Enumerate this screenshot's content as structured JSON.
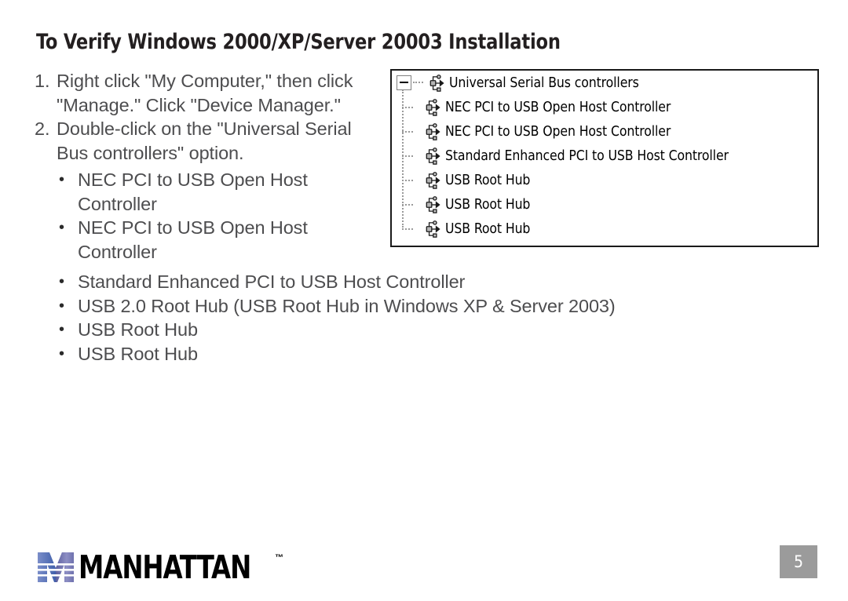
{
  "page": {
    "title": "To Verify Windows 2000/XP/Server 20003 Installation",
    "number": "5"
  },
  "instructions": {
    "steps": [
      {
        "marker": "1.",
        "line1": "Right click \"My Computer,\" then click",
        "line2": "\"Manage.\" Click \"Device Manager.\""
      },
      {
        "marker": "2.",
        "line1": "Double-click on the \"Universal Serial",
        "line2": "Bus controllers\" option."
      }
    ],
    "indented_bullets": [
      "NEC PCI to USB Open Host",
      "Controller",
      "NEC PCI to USB Open Host",
      "Controller"
    ],
    "bullets": [
      "Standard Enhanced PCI to USB Host Controller",
      "USB 2.0 Root Hub (USB Root Hub in Windows XP & Server 2003)",
      "USB Root Hub",
      "USB Root Hub"
    ]
  },
  "device_tree": {
    "root": {
      "label": "Universal Serial Bus controllers",
      "expander": "minus",
      "icon": "usb-controller-icon"
    },
    "children": [
      {
        "label": "NEC PCI to USB Open Host Controller",
        "icon": "usb-controller-icon"
      },
      {
        "label": "NEC PCI to USB Open Host Controller",
        "icon": "usb-controller-icon"
      },
      {
        "label": "Standard Enhanced PCI to USB Host Controller",
        "icon": "usb-controller-icon"
      },
      {
        "label": "USB Root Hub",
        "icon": "usb-controller-icon"
      },
      {
        "label": "USB Root Hub",
        "icon": "usb-controller-icon"
      },
      {
        "label": "USB Root Hub",
        "icon": "usb-controller-icon"
      }
    ]
  },
  "brand": {
    "name": "MANHATTAN",
    "trademark": "™",
    "emblem_colors": [
      "#3b5ba8",
      "#5c5f9e",
      "#8d8ec4",
      "#2f4a8c"
    ]
  }
}
